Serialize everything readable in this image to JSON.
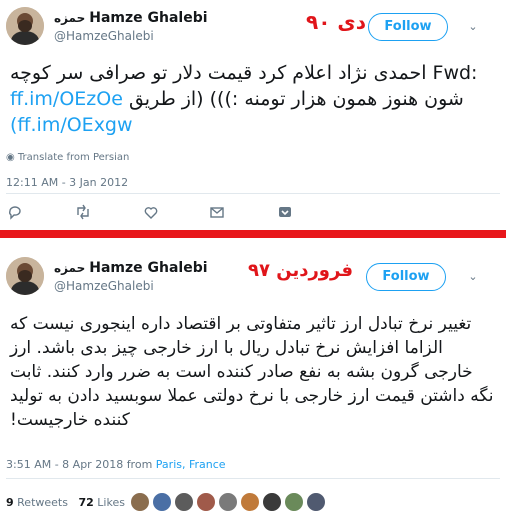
{
  "tweet1": {
    "name_fa": "حمزه",
    "name": "Hamze Ghalebi",
    "handle": "@HamzeGhalebi",
    "annotation": "دی ۹۰",
    "follow_label": "Follow",
    "text_prefix": "Fwd:",
    "text_main": " احمدی نژاد اعلام کرد قیمت دلار تو صرافی سر کوچه شون هنوز همون هزار تومنه :))) (از طریق",
    "link1": "ff.im/OEzOe",
    "link2": "(ff.im/OExgw",
    "translate": "Translate from Persian",
    "timestamp": "12:11 AM - 3 Jan 2012"
  },
  "tweet2": {
    "name_fa": "حمزه",
    "name": "Hamze Ghalebi",
    "handle": "@HamzeGhalebi",
    "annotation": "فروردین ۹۷",
    "follow_label": "Follow",
    "text": "تغییر نرخ تبادل ارز تاثیر متفاوتی بر اقتصاد داره اینجوری نیست که الزاما افزایش نرخ تبادل ریال با ارز خارجی چیز بدی باشد. ارز خارجی گرون بشه به نفع صادر کننده است به ضرر وارد کنند. ثابت نگه داشتن قیمت ارز خارجی با نرخ دولتی عملا سوبسید دادن به تولید کننده خارجیست!",
    "timestamp": "3:51 AM - 8 Apr 2018 from ",
    "location": "Paris, France",
    "retweets_count": "9",
    "retweets_label": "Retweets",
    "likes_count": "72",
    "likes_label": "Likes"
  },
  "colors": {
    "accent": "#1da1f2",
    "annotation_red": "#e0151a",
    "separator_red": "#e8171b",
    "muted": "#657786"
  },
  "icons": [
    "translate-icon",
    "reply-icon",
    "retweet-icon",
    "like-icon",
    "message-icon",
    "save-icon",
    "chevron-down-icon"
  ]
}
